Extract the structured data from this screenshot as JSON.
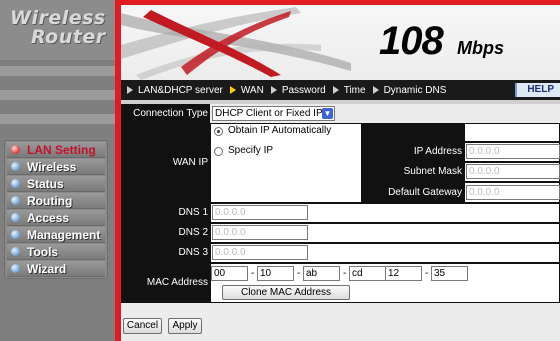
{
  "logo": {
    "line1": "Wireless",
    "line2": "Router"
  },
  "banner": {
    "speed": "108",
    "unit": "Mbps"
  },
  "nav": {
    "items": [
      "LAN&DHCP server",
      "WAN",
      "Password",
      "Time",
      "Dynamic DNS"
    ],
    "active_index": 1,
    "help": "HELP"
  },
  "sidebar": {
    "items": [
      {
        "label": "LAN Setting",
        "active": true
      },
      {
        "label": "Wireless"
      },
      {
        "label": "Status"
      },
      {
        "label": "Routing"
      },
      {
        "label": "Access"
      },
      {
        "label": "Management"
      },
      {
        "label": "Tools"
      },
      {
        "label": "Wizard"
      }
    ]
  },
  "form": {
    "connection_type_label": "Connection Type",
    "connection_type_value": "DHCP Client or Fixed IP",
    "wan_ip_label": "WAN IP",
    "obtain_auto_label": "Obtain IP Automatically",
    "specify_ip_label": "Specify IP",
    "ip_address_label": "IP Address",
    "ip_address_value": "0.0.0.0",
    "subnet_mask_label": "Subnet Mask",
    "subnet_mask_value": "0.0.0.0",
    "gateway_label": "Default Gateway",
    "gateway_value": "0.0.0.0",
    "dns1_label": "DNS 1",
    "dns1_value": "0.0.0.0",
    "dns2_label": "DNS 2",
    "dns2_value": "0.0.0.0",
    "dns3_label": "DNS 3",
    "dns3_value": "0.0.0.0",
    "mac_label": "MAC Address",
    "mac": [
      "00",
      "10",
      "ab",
      "cd",
      "12",
      "35"
    ],
    "clone_mac_label": "Clone MAC Address",
    "cancel_label": "Cancel",
    "apply_label": "Apply"
  },
  "colors": {
    "frame_red": "#e31b23",
    "navbar": "#1a1a1a",
    "active_menu": "#c8102e"
  }
}
